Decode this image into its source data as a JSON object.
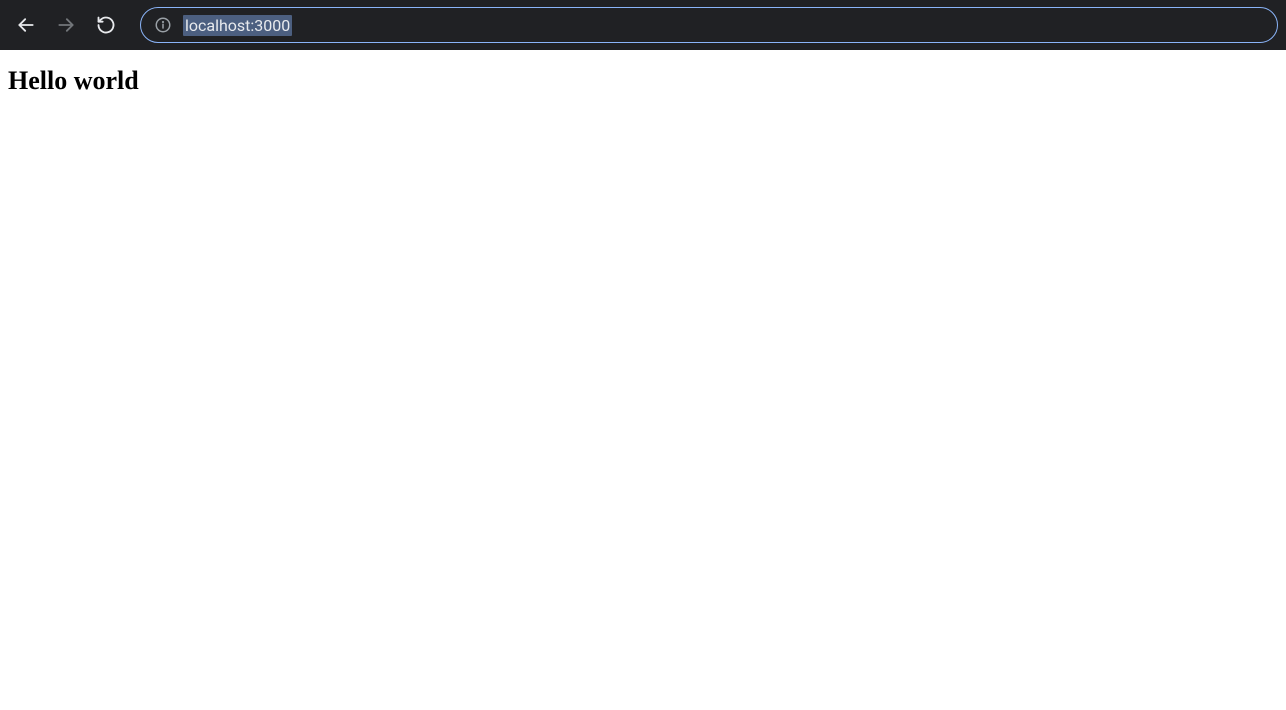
{
  "browser": {
    "url": "localhost:3000",
    "nav": {
      "back_icon": "arrow-left",
      "forward_icon": "arrow-right",
      "reload_icon": "reload"
    },
    "info_icon": "info-circle"
  },
  "page": {
    "heading": "Hello world"
  }
}
